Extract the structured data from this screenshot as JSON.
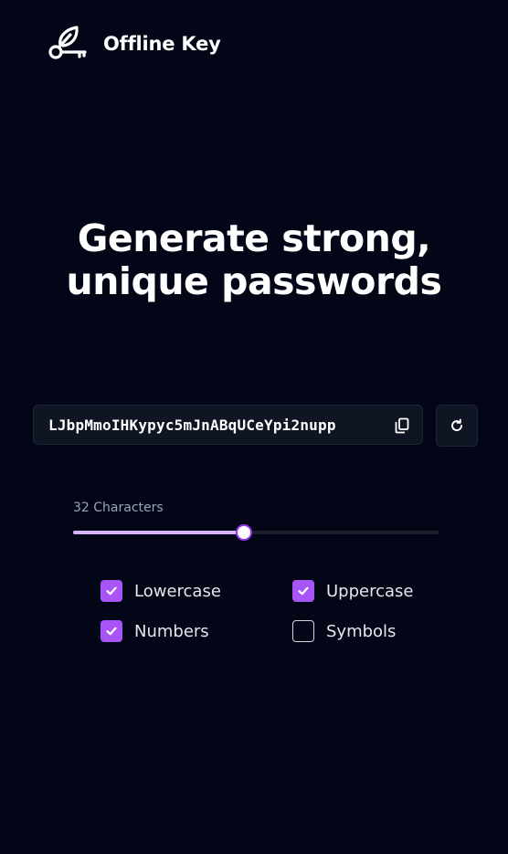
{
  "app": {
    "name": "Offline Key",
    "logo_icon": "leaf-key-icon"
  },
  "hero": {
    "line1": "Generate strong,",
    "line2": "unique passwords"
  },
  "password": {
    "value": "LJbpMmoIHKypyc5mJnABqUCeYpi2nupp",
    "copy_icon": "copy-icon",
    "refresh_icon": "refresh-icon"
  },
  "length": {
    "label": "32 Characters",
    "slider_fraction": 0.4675
  },
  "options": [
    {
      "label": "Lowercase",
      "checked": true
    },
    {
      "label": "Uppercase",
      "checked": true
    },
    {
      "label": "Numbers",
      "checked": true
    },
    {
      "label": "Symbols",
      "checked": false
    }
  ],
  "colors": {
    "background": "#020617",
    "accent": "#a855f7",
    "slider_fill": "#d8b4fe"
  }
}
